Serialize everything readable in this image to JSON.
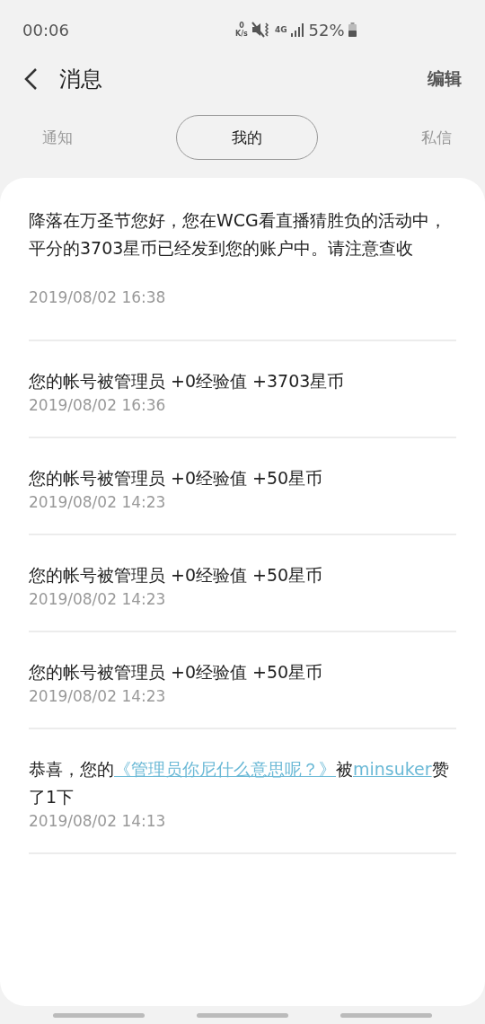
{
  "status_bar": {
    "time": "00:06",
    "net_speed_value": "0",
    "net_speed_unit": "K/s",
    "network": "4G",
    "battery": "52%"
  },
  "header": {
    "title": "消息",
    "action": "编辑"
  },
  "tabs": [
    {
      "label": "通知",
      "selected": false
    },
    {
      "label": "我的",
      "selected": true
    },
    {
      "label": "私信",
      "selected": false
    }
  ],
  "messages": [
    {
      "parts": [
        {
          "kind": "text",
          "text": "降落在万圣节您好，您在WCG看直播猜胜负的活动中，平分的3703星币已经发到您的账户中。请注意查收"
        }
      ],
      "time": "2019/08/02 16:38"
    },
    {
      "parts": [
        {
          "kind": "text",
          "text": "您的帐号被管理员 +0经验值 +3703星币"
        }
      ],
      "time": "2019/08/02 16:36"
    },
    {
      "parts": [
        {
          "kind": "text",
          "text": "您的帐号被管理员 +0经验值 +50星币"
        }
      ],
      "time": "2019/08/02 14:23"
    },
    {
      "parts": [
        {
          "kind": "text",
          "text": "您的帐号被管理员 +0经验值 +50星币"
        }
      ],
      "time": "2019/08/02 14:23"
    },
    {
      "parts": [
        {
          "kind": "text",
          "text": "您的帐号被管理员 +0经验值 +50星币"
        }
      ],
      "time": "2019/08/02 14:23"
    },
    {
      "parts": [
        {
          "kind": "text",
          "text": "恭喜，您的"
        },
        {
          "kind": "link",
          "text": "《管理员你尼什么意思呢？》"
        },
        {
          "kind": "text",
          "text": "被"
        },
        {
          "kind": "link",
          "text": "minsuker"
        },
        {
          "kind": "text",
          "text": "赞了1下"
        }
      ],
      "time": "2019/08/02 14:13"
    }
  ]
}
